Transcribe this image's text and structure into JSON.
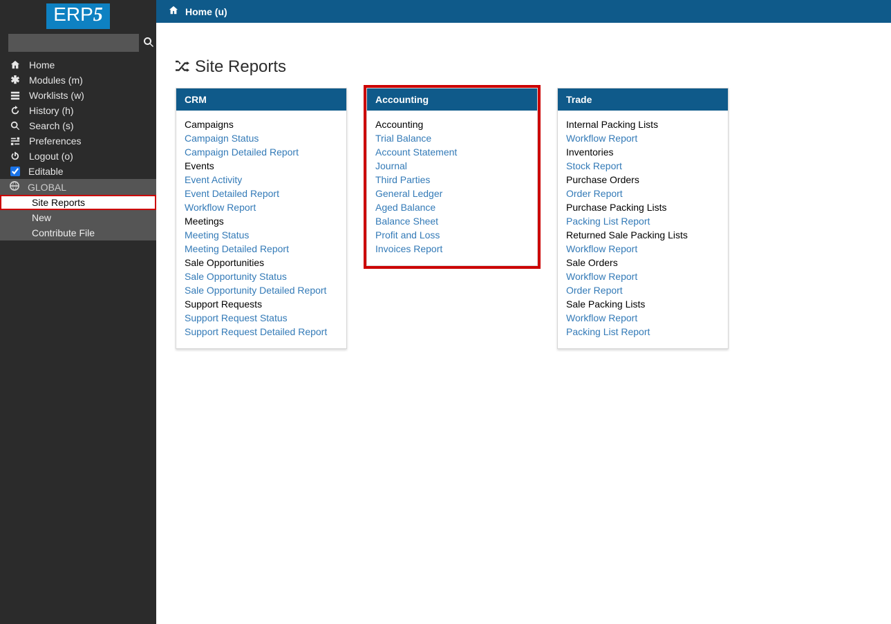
{
  "brand": {
    "text_a": "ERP",
    "text_b": "5"
  },
  "search": {
    "placeholder": ""
  },
  "nav": [
    {
      "icon": "home",
      "label": "Home"
    },
    {
      "icon": "modules",
      "label": "Modules (m)"
    },
    {
      "icon": "worklists",
      "label": "Worklists (w)"
    },
    {
      "icon": "history",
      "label": "History (h)"
    },
    {
      "icon": "search",
      "label": "Search (s)"
    },
    {
      "icon": "prefs",
      "label": "Preferences"
    },
    {
      "icon": "power",
      "label": "Logout (o)"
    }
  ],
  "editable": {
    "label": "Editable",
    "checked": true
  },
  "global": {
    "label": "GLOBAL"
  },
  "sub_nav": [
    {
      "label": "Site Reports",
      "selected": true
    },
    {
      "label": "New"
    },
    {
      "label": "Contribute File"
    }
  ],
  "breadcrumb": {
    "label": "Home (u)"
  },
  "page_title": "Site Reports",
  "panels": [
    {
      "title": "CRM",
      "highlight": false,
      "items": [
        {
          "t": "hdr",
          "label": "Campaigns"
        },
        {
          "t": "link",
          "label": "Campaign Status"
        },
        {
          "t": "link",
          "label": "Campaign Detailed Report"
        },
        {
          "t": "hdr",
          "label": "Events"
        },
        {
          "t": "link",
          "label": "Event Activity"
        },
        {
          "t": "link",
          "label": "Event Detailed Report"
        },
        {
          "t": "link",
          "label": "Workflow Report"
        },
        {
          "t": "hdr",
          "label": "Meetings"
        },
        {
          "t": "link",
          "label": "Meeting Status"
        },
        {
          "t": "link",
          "label": "Meeting Detailed Report"
        },
        {
          "t": "hdr",
          "label": "Sale Opportunities"
        },
        {
          "t": "link",
          "label": "Sale Opportunity Status"
        },
        {
          "t": "link",
          "label": "Sale Opportunity Detailed Report"
        },
        {
          "t": "hdr",
          "label": "Support Requests"
        },
        {
          "t": "link",
          "label": "Support Request Status"
        },
        {
          "t": "link",
          "label": "Support Request Detailed Report"
        }
      ]
    },
    {
      "title": "Accounting",
      "highlight": true,
      "items": [
        {
          "t": "hdr",
          "label": "Accounting"
        },
        {
          "t": "link",
          "label": "Trial Balance"
        },
        {
          "t": "link",
          "label": "Account Statement"
        },
        {
          "t": "link",
          "label": "Journal"
        },
        {
          "t": "link",
          "label": "Third Parties"
        },
        {
          "t": "link",
          "label": "General Ledger"
        },
        {
          "t": "link",
          "label": "Aged Balance"
        },
        {
          "t": "link",
          "label": "Balance Sheet"
        },
        {
          "t": "link",
          "label": "Profit and Loss"
        },
        {
          "t": "link",
          "label": "Invoices Report"
        }
      ]
    },
    {
      "title": "Trade",
      "highlight": false,
      "items": [
        {
          "t": "hdr",
          "label": "Internal Packing Lists"
        },
        {
          "t": "link",
          "label": "Workflow Report"
        },
        {
          "t": "hdr",
          "label": "Inventories"
        },
        {
          "t": "link",
          "label": "Stock Report"
        },
        {
          "t": "hdr",
          "label": "Purchase Orders"
        },
        {
          "t": "link",
          "label": "Order Report"
        },
        {
          "t": "hdr",
          "label": "Purchase Packing Lists"
        },
        {
          "t": "link",
          "label": "Packing List Report"
        },
        {
          "t": "hdr",
          "label": "Returned Sale Packing Lists"
        },
        {
          "t": "link",
          "label": "Workflow Report"
        },
        {
          "t": "hdr",
          "label": "Sale Orders"
        },
        {
          "t": "link",
          "label": "Workflow Report"
        },
        {
          "t": "link",
          "label": "Order Report"
        },
        {
          "t": "hdr",
          "label": "Sale Packing Lists"
        },
        {
          "t": "link",
          "label": "Workflow Report"
        },
        {
          "t": "link",
          "label": "Packing List Report"
        }
      ]
    }
  ]
}
